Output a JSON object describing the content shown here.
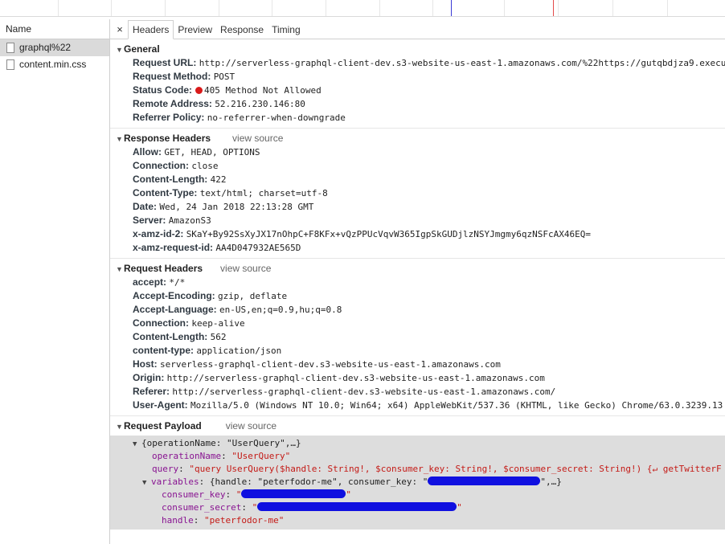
{
  "name_column": {
    "header": "Name",
    "items": [
      {
        "label": "graphql%22",
        "selected": true
      },
      {
        "label": "content.min.css",
        "selected": false
      }
    ]
  },
  "tabs": {
    "close_glyph": "×",
    "items": [
      "Headers",
      "Preview",
      "Response",
      "Timing"
    ],
    "active": "Headers"
  },
  "general": {
    "title": "General",
    "request_url_key": "Request URL:",
    "request_url": "http://serverless-graphql-client-dev.s3-website-us-east-1.amazonaws.com/%22https://gutqbdjza9.execu",
    "request_method_key": "Request Method:",
    "request_method": "POST",
    "status_code_key": "Status Code:",
    "status_code": "405 Method Not Allowed",
    "status_color": "#d91a1a",
    "remote_address_key": "Remote Address:",
    "remote_address": "52.216.230.146:80",
    "referrer_policy_key": "Referrer Policy:",
    "referrer_policy": "no-referrer-when-downgrade"
  },
  "response_headers": {
    "title": "Response Headers",
    "view_source": "view source",
    "rows": [
      {
        "k": "Allow:",
        "v": "GET, HEAD, OPTIONS"
      },
      {
        "k": "Connection:",
        "v": "close"
      },
      {
        "k": "Content-Length:",
        "v": "422"
      },
      {
        "k": "Content-Type:",
        "v": "text/html; charset=utf-8"
      },
      {
        "k": "Date:",
        "v": "Wed, 24 Jan 2018 22:13:28 GMT"
      },
      {
        "k": "Server:",
        "v": "AmazonS3"
      },
      {
        "k": "x-amz-id-2:",
        "v": "SKaY+By92SsXyJX17nOhpC+F8KFx+vQzPPUcVqvW365IgpSkGUDjlzNSYJmgmy6qzNSFcAX46EQ="
      },
      {
        "k": "x-amz-request-id:",
        "v": "AA4D047932AE565D"
      }
    ]
  },
  "request_headers": {
    "title": "Request Headers",
    "view_source": "view source",
    "rows": [
      {
        "k": "accept:",
        "v": "*/*"
      },
      {
        "k": "Accept-Encoding:",
        "v": "gzip, deflate"
      },
      {
        "k": "Accept-Language:",
        "v": "en-US,en;q=0.9,hu;q=0.8"
      },
      {
        "k": "Connection:",
        "v": "keep-alive"
      },
      {
        "k": "Content-Length:",
        "v": "562"
      },
      {
        "k": "content-type:",
        "v": "application/json"
      },
      {
        "k": "Host:",
        "v": "serverless-graphql-client-dev.s3-website-us-east-1.amazonaws.com"
      },
      {
        "k": "Origin:",
        "v": "http://serverless-graphql-client-dev.s3-website-us-east-1.amazonaws.com"
      },
      {
        "k": "Referer:",
        "v": "http://serverless-graphql-client-dev.s3-website-us-east-1.amazonaws.com/"
      },
      {
        "k": "User-Agent:",
        "v": "Mozilla/5.0 (Windows NT 10.0; Win64; x64) AppleWebKit/537.36 (KHTML, like Gecko) Chrome/63.0.3239.13"
      }
    ]
  },
  "request_payload": {
    "title": "Request Payload",
    "view_source": "view source",
    "root_summary": "{operationName: \"UserQuery\",…}",
    "operation_name_key": "operationName",
    "operation_name_value": "\"UserQuery\"",
    "query_key": "query",
    "query_value": "\"query UserQuery($handle: String!, $consumer_key: String!, $consumer_secret: String!) {↵  getTwitterF",
    "variables_key": "variables",
    "variables_summary_a": "{handle: \"peterfodor-me\", consumer_key: \"",
    "variables_summary_b": "\",…}",
    "consumer_key_key": "consumer_key",
    "consumer_secret_key": "consumer_secret",
    "handle_key": "handle",
    "handle_value": "\"peterfodor-me\"",
    "redaction_color": "#1010e0"
  }
}
